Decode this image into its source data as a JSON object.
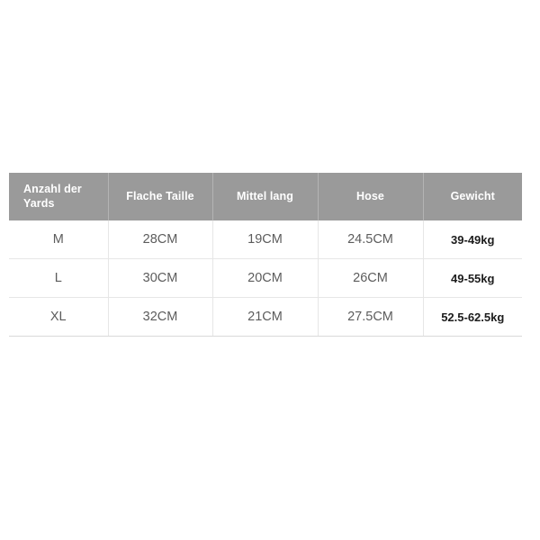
{
  "chart_data": {
    "type": "table",
    "title": "",
    "columns": [
      "Anzahl der Yards",
      "Flache Taille",
      "Mittel lang",
      "Hose",
      "Gewicht"
    ],
    "rows": [
      [
        "M",
        "28CM",
        "19CM",
        "24.5CM",
        "39-49kg"
      ],
      [
        "L",
        "30CM",
        "20CM",
        "26CM",
        "49-55kg"
      ],
      [
        "XL",
        "32CM",
        "21CM",
        "27.5CM",
        "52.5-62.5kg"
      ]
    ]
  },
  "size_chart": {
    "headers": [
      {
        "label": "Anzahl der Yards",
        "name": "header-anzahl-der-yards"
      },
      {
        "label": "Flache Taille",
        "name": "header-flache-taille"
      },
      {
        "label": "Mittel lang",
        "name": "header-mittel-lang"
      },
      {
        "label": "Hose",
        "name": "header-hose"
      },
      {
        "label": "Gewicht",
        "name": "header-gewicht"
      }
    ],
    "rows": [
      {
        "size": "M",
        "flache_taille": "28CM",
        "mittel_lang": "19CM",
        "hose": "24.5CM",
        "gewicht": "39-49kg"
      },
      {
        "size": "L",
        "flache_taille": "30CM",
        "mittel_lang": "20CM",
        "hose": "26CM",
        "gewicht": "49-55kg"
      },
      {
        "size": "XL",
        "flache_taille": "32CM",
        "mittel_lang": "21CM",
        "hose": "27.5CM",
        "gewicht": "52.5-62.5kg"
      }
    ]
  },
  "colors": {
    "header_background": "#9a9a9a",
    "header_text": "#ffffff",
    "body_text": "#5c5c5c",
    "weight_text": "#1c1c1c",
    "grid_line": "#e6e6e6",
    "page_background": "#ffffff"
  }
}
